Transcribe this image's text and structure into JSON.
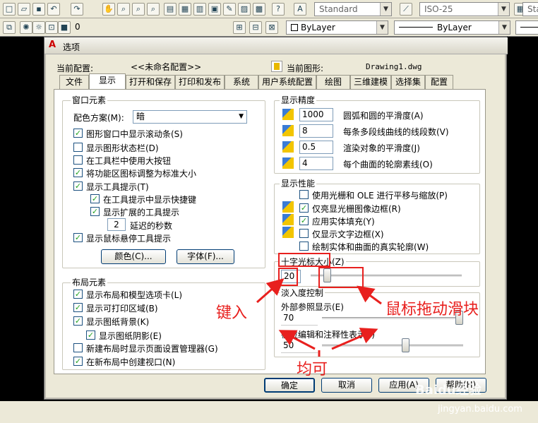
{
  "toolbar": {
    "text_style": "Standard",
    "dim_style": "ISO-25",
    "right_style": "Standar",
    "layer_value": "0",
    "color": "ByLayer",
    "linetype": "ByLayer"
  },
  "dialog": {
    "title": "选项",
    "current_profile_label": "当前配置:",
    "current_profile_value": "<<未命名配置>>",
    "current_drawing_label": "当前图形:",
    "current_drawing_value": "Drawing1.dwg",
    "tabs": [
      "文件",
      "显示",
      "打开和保存",
      "打印和发布",
      "系统",
      "用户系统配置",
      "绘图",
      "三维建模",
      "选择集",
      "配置"
    ],
    "selected_tab": "显示",
    "window_elements": {
      "title": "窗口元素",
      "color_scheme_label": "配色方案(M):",
      "color_scheme_value": "暗",
      "options": [
        {
          "label": "图形窗口中显示滚动条(S)",
          "checked": true
        },
        {
          "label": "显示图形状态栏(D)",
          "checked": false
        },
        {
          "label": "在工具栏中使用大按钮",
          "checked": false
        },
        {
          "label": "将功能区图标调整为标准大小",
          "checked": true
        },
        {
          "label": "显示工具提示(T)",
          "checked": true
        },
        {
          "label": "在工具提示中显示快捷键",
          "checked": true
        },
        {
          "label": "显示扩展的工具提示",
          "checked": true
        },
        {
          "label": "显示鼠标悬停工具提示",
          "checked": true
        }
      ],
      "delay_value": "2",
      "delay_label": "延迟的秒数",
      "colors_button": "颜色(C)...",
      "fonts_button": "字体(F)..."
    },
    "layout_elements": {
      "title": "布局元素",
      "options": [
        {
          "label": "显示布局和模型选项卡(L)",
          "checked": true
        },
        {
          "label": "显示可打印区域(B)",
          "checked": true
        },
        {
          "label": "显示图纸背景(K)",
          "checked": true
        },
        {
          "label": "显示图纸阴影(E)",
          "checked": true
        },
        {
          "label": "新建布局时显示页面设置管理器(G)",
          "checked": false
        },
        {
          "label": "在新布局中创建视口(N)",
          "checked": true
        }
      ]
    },
    "display_resolution": {
      "title": "显示精度",
      "rows": [
        {
          "value": "1000",
          "label": "圆弧和圆的平滑度(A)"
        },
        {
          "value": "8",
          "label": "每条多段线曲线的线段数(V)"
        },
        {
          "value": "0.5",
          "label": "渲染对象的平滑度(J)"
        },
        {
          "value": "4",
          "label": "每个曲面的轮廓素线(O)"
        }
      ]
    },
    "display_performance": {
      "title": "显示性能",
      "options": [
        {
          "label": "使用光栅和 OLE 进行平移与缩放(P)",
          "checked": false
        },
        {
          "label": "仅亮显光栅图像边框(R)",
          "checked": true
        },
        {
          "label": "应用实体填充(Y)",
          "checked": true
        },
        {
          "label": "仅显示文字边框(X)",
          "checked": false
        },
        {
          "label": "绘制实体和曲面的真实轮廓(W)",
          "checked": false
        }
      ]
    },
    "crosshair": {
      "title": "十字光标大小(Z)",
      "value": "20",
      "level": 20
    },
    "fade": {
      "title": "淡入度控制",
      "xref_label": "外部参照显示(E)",
      "xref_value": "70",
      "xref_level": 70,
      "inplace_label": "在位编辑和注释性表示(I)",
      "inplace_value": "50",
      "inplace_level": 50
    },
    "buttons": {
      "ok": "确定",
      "cancel": "取消",
      "apply": "应用(A)",
      "help": "帮助(H)"
    }
  },
  "annotations": {
    "type_in": "键入",
    "drag_slider": "鼠标拖动滑块",
    "either": "均可"
  },
  "watermark": {
    "brand": "Baidu经验",
    "url": "jingyan.baidu.com"
  },
  "colors": {
    "annotation_red": "#e8201e",
    "dialog_bg": "#ECE9D8",
    "check_green": "#21a121"
  }
}
